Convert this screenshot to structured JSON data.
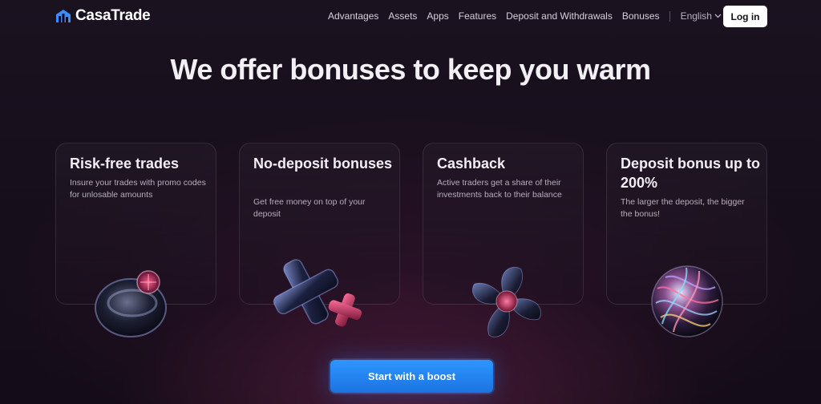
{
  "brand": {
    "name": "CasaTrade",
    "logo_icon": "bar-chart-house-icon"
  },
  "nav": {
    "items": [
      {
        "label": "Advantages"
      },
      {
        "label": "Assets"
      },
      {
        "label": "Apps"
      },
      {
        "label": "Features"
      },
      {
        "label": "Deposit and Withdrawals"
      },
      {
        "label": "Bonuses"
      }
    ],
    "language": "English",
    "login_label": "Log in"
  },
  "hero": {
    "title": "We offer bonuses to keep you warm"
  },
  "cards": [
    {
      "title": "Risk-free trades",
      "description": "Insure your trades with promo codes for unlosable amounts",
      "art": "glass-disc-icon"
    },
    {
      "title": "No-deposit bonuses",
      "description": "Get free money on top of your deposit",
      "art": "glass-plus-icon"
    },
    {
      "title": "Cashback",
      "description": "Active traders get a share of their investments back to their balance",
      "art": "glass-flower-icon"
    },
    {
      "title": "Deposit bonus up to 200%",
      "description": "The larger the deposit, the bigger the bonus!",
      "art": "glass-sphere-icon"
    }
  ],
  "cta": {
    "label": "Start with a boost"
  },
  "colors": {
    "accent": "#1f7ff0",
    "background": "#170f1c",
    "card_border": "#3a3040"
  }
}
